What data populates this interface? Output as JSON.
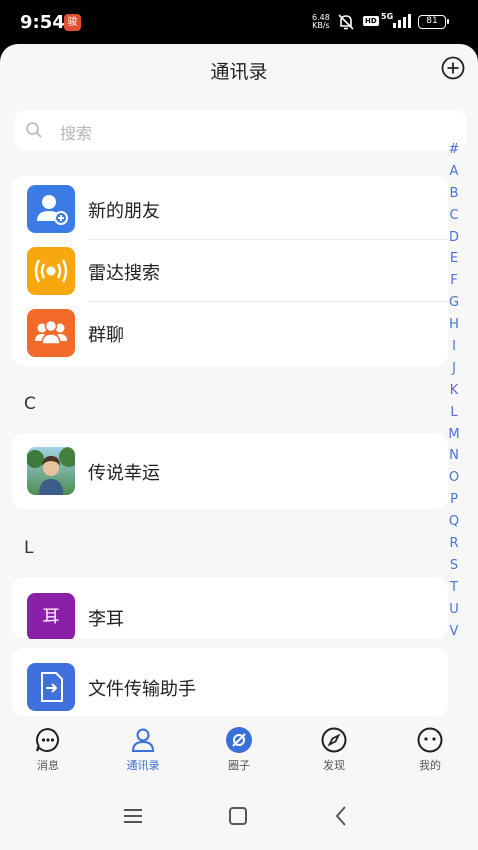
{
  "status_bar": {
    "time": "9:54",
    "app_badge": "骏",
    "net_speed_value": "6.48",
    "net_speed_unit": "KB/s",
    "hd_label": "HD",
    "network_label": "5G",
    "battery": "81"
  },
  "header": {
    "title": "通讯录",
    "add_icon": "plus-circle-icon"
  },
  "search": {
    "placeholder": "搜索",
    "icon": "search-icon"
  },
  "quick_entries": [
    {
      "label": "新的朋友",
      "icon": "add-friend-icon",
      "color": "#3b7be6"
    },
    {
      "label": "雷达搜索",
      "icon": "radar-icon",
      "color": "#f7a80f"
    },
    {
      "label": "群聊",
      "icon": "group-chat-icon",
      "color": "#f26a2a"
    }
  ],
  "sections": [
    {
      "header": "C",
      "contacts": [
        {
          "name": "传说幸运",
          "avatar": "photo"
        }
      ]
    },
    {
      "header": "L",
      "contacts": [
        {
          "name": "李耳",
          "avatar_text": "耳",
          "avatar_color": "#8a1fa8"
        }
      ]
    }
  ],
  "file_helper": {
    "label": "文件传输助手",
    "icon": "file-transfer-icon",
    "color": "#3f70dd"
  },
  "index_letters": [
    "#",
    "A",
    "B",
    "C",
    "D",
    "E",
    "F",
    "G",
    "H",
    "I",
    "J",
    "K",
    "L",
    "M",
    "N",
    "O",
    "P",
    "Q",
    "R",
    "S",
    "T",
    "U",
    "V"
  ],
  "tabs": [
    {
      "label": "消息",
      "icon": "chat-bubble-icon",
      "active": false
    },
    {
      "label": "通讯录",
      "icon": "contacts-person-icon",
      "active": true
    },
    {
      "label": "圈子",
      "icon": "circle-icon",
      "active": false
    },
    {
      "label": "发现",
      "icon": "compass-icon",
      "active": false
    },
    {
      "label": "我的",
      "icon": "profile-face-icon",
      "active": false
    }
  ],
  "colors": {
    "accent": "#3a6fd8",
    "background": "#f7f7f7",
    "card": "#ffffff"
  }
}
